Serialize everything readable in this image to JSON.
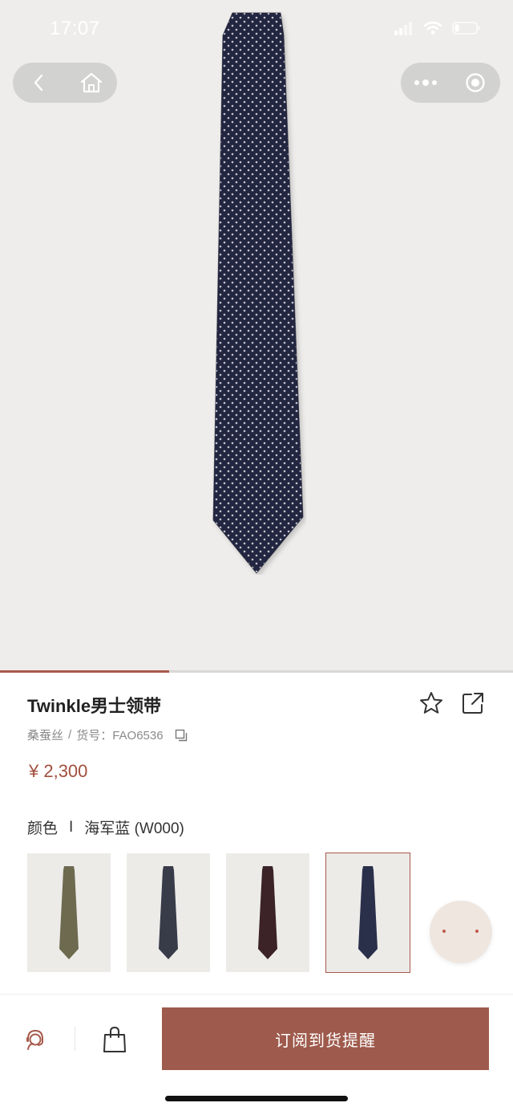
{
  "status_bar": {
    "time": "17:07"
  },
  "capsule": {
    "left_icons": [
      "back-icon",
      "home-icon"
    ],
    "right_icons": [
      "more-icon",
      "target-icon"
    ]
  },
  "gallery": {
    "progress": 0.33,
    "accent_color": "#a65a4b"
  },
  "product": {
    "title": "Twinkle男士领带",
    "material": "桑蚕丝",
    "sku_separator": "/",
    "sku_label": "货号：FAO6536",
    "price": "¥ 2,300",
    "price_color": "#a24f3d"
  },
  "color_selector": {
    "label": "颜色",
    "separator": "I",
    "selected": "海军蓝 (W000)",
    "swatches": [
      {
        "color": "#6e6a50",
        "selected": false
      },
      {
        "color": "#383b48",
        "selected": false
      },
      {
        "color": "#3b2328",
        "selected": false
      },
      {
        "color": "#2a2f4a",
        "selected": true
      }
    ]
  },
  "bottom_bar": {
    "cta_label": "订阅到货提醒",
    "cta_color": "#9e5a4c",
    "icons": [
      "customer-service-icon",
      "shopping-bag-icon"
    ]
  }
}
